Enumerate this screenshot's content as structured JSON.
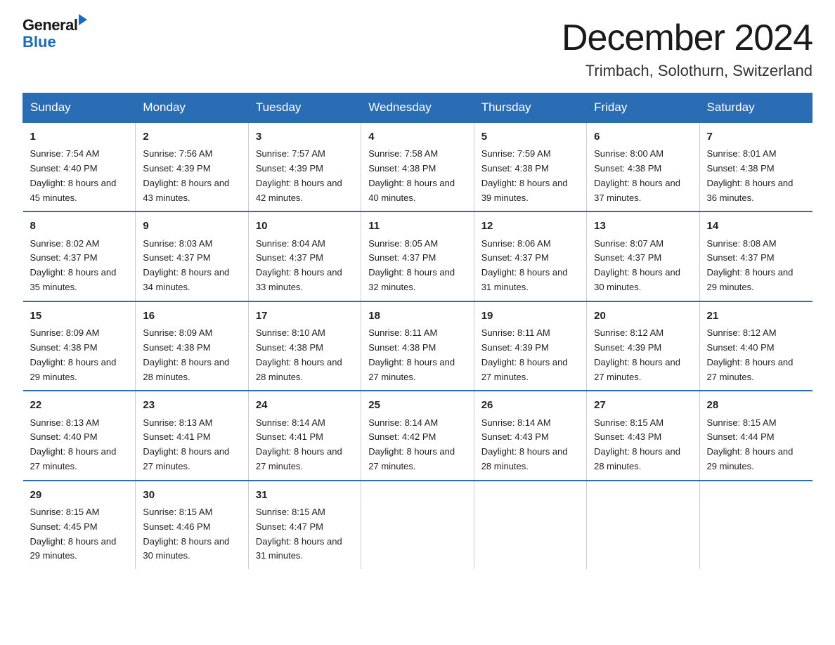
{
  "header": {
    "logo_general": "General",
    "logo_blue": "Blue",
    "month_title": "December 2024",
    "location": "Trimbach, Solothurn, Switzerland"
  },
  "days_of_week": [
    "Sunday",
    "Monday",
    "Tuesday",
    "Wednesday",
    "Thursday",
    "Friday",
    "Saturday"
  ],
  "weeks": [
    [
      {
        "day": "1",
        "sunrise": "7:54 AM",
        "sunset": "4:40 PM",
        "daylight": "8 hours and 45 minutes."
      },
      {
        "day": "2",
        "sunrise": "7:56 AM",
        "sunset": "4:39 PM",
        "daylight": "8 hours and 43 minutes."
      },
      {
        "day": "3",
        "sunrise": "7:57 AM",
        "sunset": "4:39 PM",
        "daylight": "8 hours and 42 minutes."
      },
      {
        "day": "4",
        "sunrise": "7:58 AM",
        "sunset": "4:38 PM",
        "daylight": "8 hours and 40 minutes."
      },
      {
        "day": "5",
        "sunrise": "7:59 AM",
        "sunset": "4:38 PM",
        "daylight": "8 hours and 39 minutes."
      },
      {
        "day": "6",
        "sunrise": "8:00 AM",
        "sunset": "4:38 PM",
        "daylight": "8 hours and 37 minutes."
      },
      {
        "day": "7",
        "sunrise": "8:01 AM",
        "sunset": "4:38 PM",
        "daylight": "8 hours and 36 minutes."
      }
    ],
    [
      {
        "day": "8",
        "sunrise": "8:02 AM",
        "sunset": "4:37 PM",
        "daylight": "8 hours and 35 minutes."
      },
      {
        "day": "9",
        "sunrise": "8:03 AM",
        "sunset": "4:37 PM",
        "daylight": "8 hours and 34 minutes."
      },
      {
        "day": "10",
        "sunrise": "8:04 AM",
        "sunset": "4:37 PM",
        "daylight": "8 hours and 33 minutes."
      },
      {
        "day": "11",
        "sunrise": "8:05 AM",
        "sunset": "4:37 PM",
        "daylight": "8 hours and 32 minutes."
      },
      {
        "day": "12",
        "sunrise": "8:06 AM",
        "sunset": "4:37 PM",
        "daylight": "8 hours and 31 minutes."
      },
      {
        "day": "13",
        "sunrise": "8:07 AM",
        "sunset": "4:37 PM",
        "daylight": "8 hours and 30 minutes."
      },
      {
        "day": "14",
        "sunrise": "8:08 AM",
        "sunset": "4:37 PM",
        "daylight": "8 hours and 29 minutes."
      }
    ],
    [
      {
        "day": "15",
        "sunrise": "8:09 AM",
        "sunset": "4:38 PM",
        "daylight": "8 hours and 29 minutes."
      },
      {
        "day": "16",
        "sunrise": "8:09 AM",
        "sunset": "4:38 PM",
        "daylight": "8 hours and 28 minutes."
      },
      {
        "day": "17",
        "sunrise": "8:10 AM",
        "sunset": "4:38 PM",
        "daylight": "8 hours and 28 minutes."
      },
      {
        "day": "18",
        "sunrise": "8:11 AM",
        "sunset": "4:38 PM",
        "daylight": "8 hours and 27 minutes."
      },
      {
        "day": "19",
        "sunrise": "8:11 AM",
        "sunset": "4:39 PM",
        "daylight": "8 hours and 27 minutes."
      },
      {
        "day": "20",
        "sunrise": "8:12 AM",
        "sunset": "4:39 PM",
        "daylight": "8 hours and 27 minutes."
      },
      {
        "day": "21",
        "sunrise": "8:12 AM",
        "sunset": "4:40 PM",
        "daylight": "8 hours and 27 minutes."
      }
    ],
    [
      {
        "day": "22",
        "sunrise": "8:13 AM",
        "sunset": "4:40 PM",
        "daylight": "8 hours and 27 minutes."
      },
      {
        "day": "23",
        "sunrise": "8:13 AM",
        "sunset": "4:41 PM",
        "daylight": "8 hours and 27 minutes."
      },
      {
        "day": "24",
        "sunrise": "8:14 AM",
        "sunset": "4:41 PM",
        "daylight": "8 hours and 27 minutes."
      },
      {
        "day": "25",
        "sunrise": "8:14 AM",
        "sunset": "4:42 PM",
        "daylight": "8 hours and 27 minutes."
      },
      {
        "day": "26",
        "sunrise": "8:14 AM",
        "sunset": "4:43 PM",
        "daylight": "8 hours and 28 minutes."
      },
      {
        "day": "27",
        "sunrise": "8:15 AM",
        "sunset": "4:43 PM",
        "daylight": "8 hours and 28 minutes."
      },
      {
        "day": "28",
        "sunrise": "8:15 AM",
        "sunset": "4:44 PM",
        "daylight": "8 hours and 29 minutes."
      }
    ],
    [
      {
        "day": "29",
        "sunrise": "8:15 AM",
        "sunset": "4:45 PM",
        "daylight": "8 hours and 29 minutes."
      },
      {
        "day": "30",
        "sunrise": "8:15 AM",
        "sunset": "4:46 PM",
        "daylight": "8 hours and 30 minutes."
      },
      {
        "day": "31",
        "sunrise": "8:15 AM",
        "sunset": "4:47 PM",
        "daylight": "8 hours and 31 minutes."
      },
      {
        "day": "",
        "sunrise": "",
        "sunset": "",
        "daylight": ""
      },
      {
        "day": "",
        "sunrise": "",
        "sunset": "",
        "daylight": ""
      },
      {
        "day": "",
        "sunrise": "",
        "sunset": "",
        "daylight": ""
      },
      {
        "day": "",
        "sunrise": "",
        "sunset": "",
        "daylight": ""
      }
    ]
  ],
  "labels": {
    "sunrise_prefix": "Sunrise: ",
    "sunset_prefix": "Sunset: ",
    "daylight_prefix": "Daylight: "
  }
}
